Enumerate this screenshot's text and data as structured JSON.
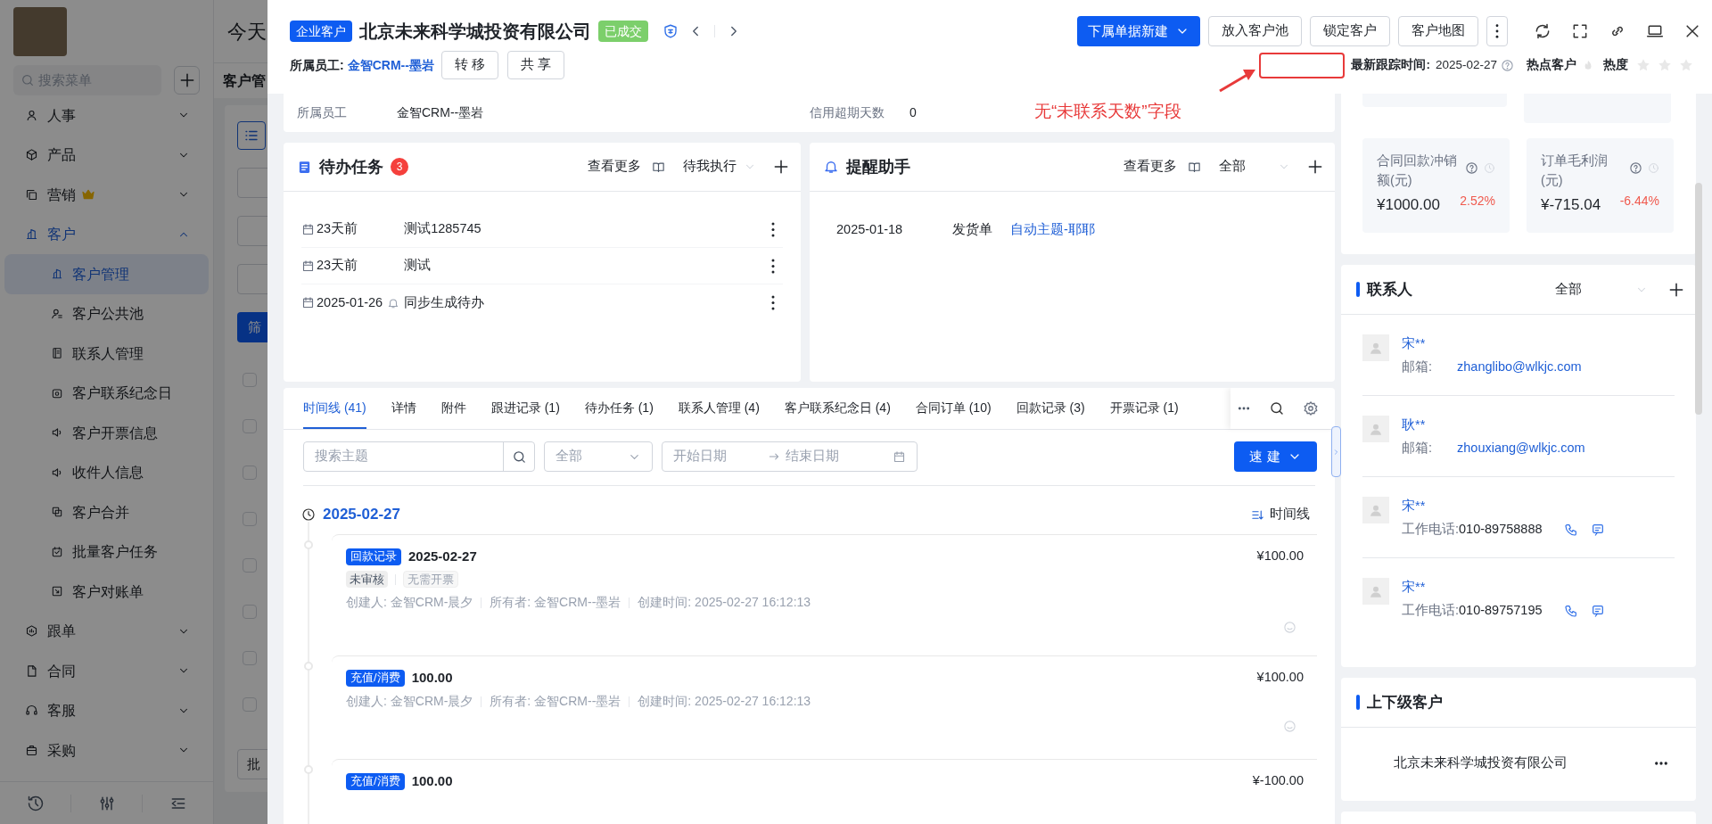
{
  "background_app": {
    "greeting": "今天",
    "menu_search": {
      "placeholder": "搜索菜单"
    },
    "menu": [
      {
        "label": "人事",
        "expanded": false,
        "selected": false,
        "premium": false
      },
      {
        "label": "产品",
        "expanded": false,
        "selected": false,
        "premium": false
      },
      {
        "label": "营销",
        "expanded": false,
        "selected": false,
        "premium": true
      },
      {
        "label": "客户",
        "expanded": true,
        "selected": true,
        "premium": false,
        "children": [
          {
            "label": "客户管理",
            "selected": true
          },
          {
            "label": "客户公共池",
            "selected": false
          },
          {
            "label": "联系人管理",
            "selected": false
          },
          {
            "label": "客户联系纪念日",
            "selected": false
          },
          {
            "label": "客户开票信息",
            "selected": false
          },
          {
            "label": "收件人信息",
            "selected": false
          },
          {
            "label": "客户合并",
            "selected": false
          },
          {
            "label": "批量客户任务",
            "selected": false
          },
          {
            "label": "客户对账单",
            "selected": false
          }
        ]
      },
      {
        "label": "跟单",
        "expanded": false,
        "selected": false,
        "premium": false
      },
      {
        "label": "合同",
        "expanded": false,
        "selected": false,
        "premium": false
      },
      {
        "label": "客服",
        "expanded": false,
        "selected": false,
        "premium": false
      },
      {
        "label": "采购",
        "expanded": false,
        "selected": false,
        "premium": false
      }
    ],
    "page_title": "客户管",
    "filter_button": "筛",
    "batch_button": "批",
    "row_checkboxes": [
      {
        "checked": false
      },
      {
        "checked": false
      },
      {
        "checked": false
      },
      {
        "checked": false
      },
      {
        "checked": false
      },
      {
        "checked": false
      },
      {
        "checked": false
      },
      {
        "checked": false
      }
    ]
  },
  "drawer": {
    "header": {
      "type_badge": "企业客户",
      "title": "北京未来科学城投资有限公司",
      "status_badge": "已成交",
      "owner_label": "所属员工:",
      "owner": "金智CRM--墨岩",
      "owner_actions": [
        "转 移",
        "共 享"
      ],
      "primary_action": "下属单据新建",
      "actions": [
        "放入客户池",
        "锁定客户",
        "客户地图"
      ],
      "last_follow_label": "最新跟踪时间:",
      "last_follow": "2025-02-27",
      "hot_label": "热点客户",
      "hot": false,
      "heat_label": "热度",
      "stars": 0
    },
    "annotation": {
      "text": "无“未联系天数”字段"
    },
    "info": [
      {
        "label": "所属员工",
        "value": "金智CRM--墨岩"
      },
      {
        "label": "信用超期天数",
        "value": "0"
      }
    ],
    "tasks": {
      "title": "待办任务",
      "count": "3",
      "more": "查看更多",
      "filter": "待我执行",
      "items": [
        {
          "time": "23天前",
          "name": "测试1285745",
          "reminder": false
        },
        {
          "time": "23天前",
          "name": "测试",
          "reminder": false
        },
        {
          "time": "2025-01-26",
          "name": "同步生成待办",
          "reminder": true
        }
      ]
    },
    "reminders": {
      "title": "提醒助手",
      "more": "查看更多",
      "filter": "全部",
      "items": [
        {
          "date": "2025-01-18",
          "type": "发货单",
          "subject": "自动主题-耶耶"
        }
      ]
    },
    "tabs": [
      {
        "label": "时间线 (41)",
        "selected": true
      },
      {
        "label": "详情",
        "selected": false
      },
      {
        "label": "附件",
        "selected": false
      },
      {
        "label": "跟进记录 (1)",
        "selected": false
      },
      {
        "label": "待办任务 (1)",
        "selected": false
      },
      {
        "label": "联系人管理 (4)",
        "selected": false
      },
      {
        "label": "客户联系纪念日 (4)",
        "selected": false
      },
      {
        "label": "合同订单 (10)",
        "selected": false
      },
      {
        "label": "回款记录 (3)",
        "selected": false
      },
      {
        "label": "开票记录 (1)",
        "selected": false
      }
    ],
    "toolbar": {
      "search": {
        "placeholder": "搜索主题"
      },
      "type_filter": "全部",
      "start_date": {
        "placeholder": "开始日期"
      },
      "end_date": {
        "placeholder": "结束日期"
      },
      "quick_create": "速 建"
    },
    "timeline": {
      "date": "2025-02-27",
      "view": "时间线",
      "entries": [
        {
          "tag": "回款记录",
          "title": "2025-02-27",
          "amount": "¥100.00",
          "statuses": [
            {
              "label": "未审核",
              "muted": false
            },
            {
              "label": "无需开票",
              "muted": true
            }
          ],
          "meta": [
            "创建人: 金智CRM-晨夕",
            "所有者: 金智CRM--墨岩",
            "创建时间: 2025-02-27 16:12:13"
          ]
        },
        {
          "tag": "充值/消费",
          "title": "100.00",
          "amount": "¥100.00",
          "meta": [
            "创建人: 金智CRM-晨夕",
            "所有者: 金智CRM--墨岩",
            "创建时间: 2025-02-27 16:12:13"
          ]
        },
        {
          "tag": "充值/消费",
          "title": "100.00",
          "amount": "¥-100.00"
        }
      ]
    },
    "stats": [
      {
        "label": "合同回款冲销额(元)",
        "value": "¥1000.00",
        "change": "2.52%"
      },
      {
        "label": "订单毛利润(元)",
        "value": "¥-715.04",
        "change": "-6.44%"
      }
    ],
    "contacts": {
      "title": "联系人",
      "filter": "全部",
      "items": [
        {
          "name": "宋**",
          "kind": "email",
          "field": "邮箱:",
          "value": "zhanglibo@wlkjc.com"
        },
        {
          "name": "耿**",
          "kind": "email",
          "field": "邮箱:",
          "value": "zhouxiang@wlkjc.com"
        },
        {
          "name": "宋**",
          "kind": "phone",
          "field": "工作电话:",
          "value": "010-89758888"
        },
        {
          "name": "宋**",
          "kind": "phone",
          "field": "工作电话:",
          "value": "010-89757195"
        }
      ]
    },
    "related": {
      "title": "上下级客户",
      "items": [
        {
          "name": "北京未来科学城投资有限公司"
        }
      ]
    }
  }
}
